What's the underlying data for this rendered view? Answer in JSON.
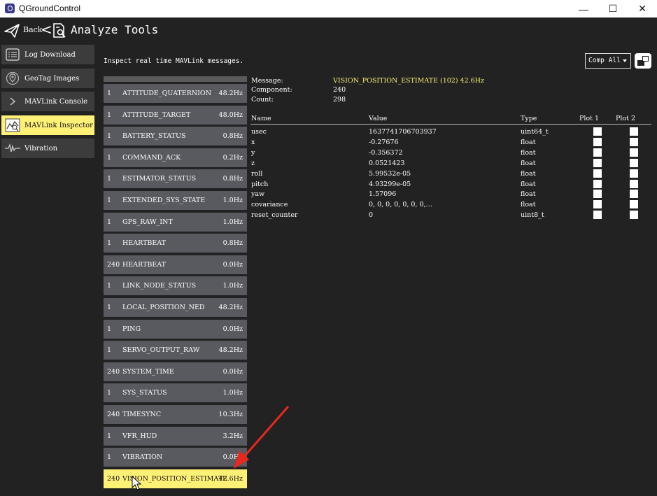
{
  "window": {
    "title": "QGroundControl",
    "controls": [
      "—",
      "☐",
      "✕"
    ]
  },
  "toolbar": {
    "back_label": "Back",
    "chevron": "<",
    "page_title": "Analyze Tools"
  },
  "sidebar": {
    "items": [
      {
        "label": "Log Download",
        "icon": "list-icon",
        "active": false
      },
      {
        "label": "GeoTag Images",
        "icon": "map-pin-icon",
        "active": false
      },
      {
        "label": "MAVLink Console",
        "icon": "chevron-right-icon",
        "active": false
      },
      {
        "label": "MAVLink Inspector",
        "icon": "chart-icon",
        "active": true
      },
      {
        "label": "Vibration",
        "icon": "waveform-icon",
        "active": false
      }
    ]
  },
  "main": {
    "inspect_label": "Inspect real time MAVLink messages.",
    "comp_select": "Comp All"
  },
  "messages": [
    {
      "comp": "1",
      "name": "ATTITUDE_QUATERNION",
      "hz": "48.2Hz"
    },
    {
      "comp": "1",
      "name": "ATTITUDE_TARGET",
      "hz": "48.0Hz"
    },
    {
      "comp": "1",
      "name": "BATTERY_STATUS",
      "hz": "0.8Hz"
    },
    {
      "comp": "1",
      "name": "COMMAND_ACK",
      "hz": "0.2Hz"
    },
    {
      "comp": "1",
      "name": "ESTIMATOR_STATUS",
      "hz": "0.8Hz"
    },
    {
      "comp": "1",
      "name": "EXTENDED_SYS_STATE",
      "hz": "1.0Hz"
    },
    {
      "comp": "1",
      "name": "GPS_RAW_INT",
      "hz": "1.0Hz"
    },
    {
      "comp": "1",
      "name": "HEARTBEAT",
      "hz": "0.8Hz"
    },
    {
      "comp": "240",
      "name": "HEARTBEAT",
      "hz": "0.0Hz"
    },
    {
      "comp": "1",
      "name": "LINK_NODE_STATUS",
      "hz": "1.0Hz"
    },
    {
      "comp": "1",
      "name": "LOCAL_POSITION_NED",
      "hz": "48.2Hz"
    },
    {
      "comp": "1",
      "name": "PING",
      "hz": "0.0Hz"
    },
    {
      "comp": "1",
      "name": "SERVO_OUTPUT_RAW",
      "hz": "48.2Hz"
    },
    {
      "comp": "240",
      "name": "SYSTEM_TIME",
      "hz": "0.0Hz"
    },
    {
      "comp": "1",
      "name": "SYS_STATUS",
      "hz": "1.0Hz"
    },
    {
      "comp": "240",
      "name": "TIMESYNC",
      "hz": "10.3Hz"
    },
    {
      "comp": "1",
      "name": "VFR_HUD",
      "hz": "3.2Hz"
    },
    {
      "comp": "1",
      "name": "VIBRATION",
      "hz": "0.0Hz"
    },
    {
      "comp": "240",
      "name": "VISION_POSITION_ESTIMATE",
      "hz": "42.6Hz",
      "selected": true
    }
  ],
  "detail": {
    "message_label": "Message:",
    "message_value": "VISION_POSITION_ESTIMATE (102) 42.6Hz",
    "component_label": "Component:",
    "component_value": "240",
    "count_label": "Count:",
    "count_value": "298",
    "headers": {
      "name": "Name",
      "value": "Value",
      "type": "Type",
      "plot1": "Plot 1",
      "plot2": "Plot 2"
    },
    "fields": [
      {
        "name": "usec",
        "value": "1637741706703937",
        "type": "uint64_t"
      },
      {
        "name": "x",
        "value": "-0.27676",
        "type": "float"
      },
      {
        "name": "y",
        "value": "-0.356372",
        "type": "float"
      },
      {
        "name": "z",
        "value": "0.0521423",
        "type": "float"
      },
      {
        "name": "roll",
        "value": "5.99532e-05",
        "type": "float"
      },
      {
        "name": "pitch",
        "value": "4.93299e-05",
        "type": "float"
      },
      {
        "name": "yaw",
        "value": "1.57096",
        "type": "float"
      },
      {
        "name": "covariance",
        "value": "0, 0, 0, 0, 0, 0, 0,…",
        "type": "float"
      },
      {
        "name": "reset_counter",
        "value": "0",
        "type": "uint8_t"
      }
    ]
  },
  "colors": {
    "background": "#222222",
    "row": "#585a60",
    "highlight": "#fff176",
    "annotation_arrow": "#e8281e"
  }
}
